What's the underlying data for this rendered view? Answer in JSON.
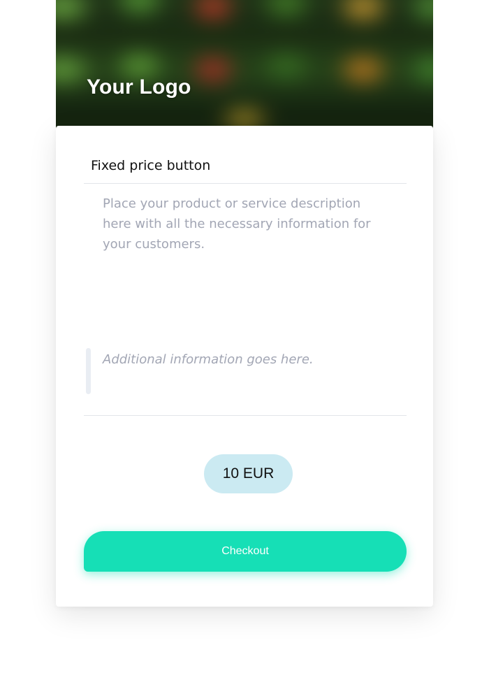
{
  "header": {
    "logo_text": "Your Logo"
  },
  "product": {
    "title": "Fixed price button",
    "description": "Place your product or service description here with all the necessary information for your customers.",
    "additional_info": "Additional information goes here.",
    "price": "10 EUR"
  },
  "actions": {
    "checkout_label": "Checkout"
  },
  "colors": {
    "accent": "#16dfb6",
    "price_pill": "#cbeaf2",
    "muted_text": "#a2a6b4"
  }
}
